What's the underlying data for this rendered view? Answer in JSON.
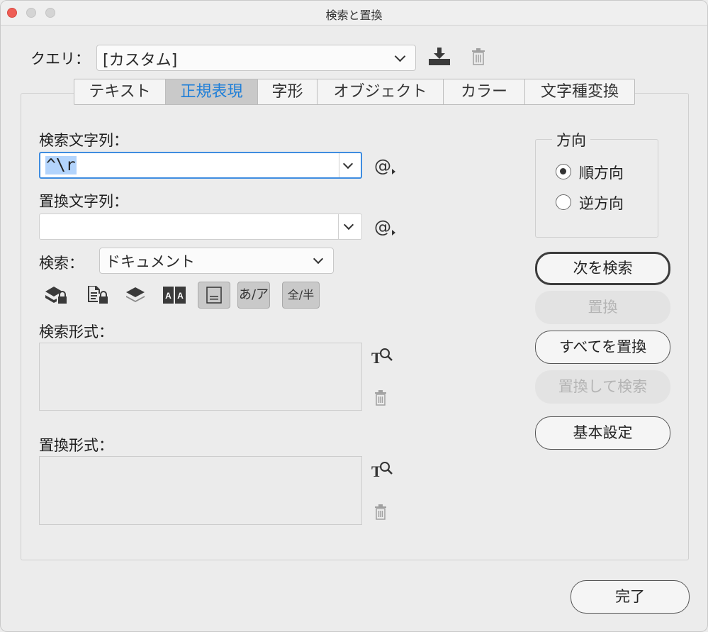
{
  "window": {
    "title": "検索と置換"
  },
  "query": {
    "label": "クエリ：",
    "value": "[カスタム]"
  },
  "tabs": [
    {
      "label": "テキスト"
    },
    {
      "label": "正規表現",
      "active": true
    },
    {
      "label": "字形"
    },
    {
      "label": "オブジェクト"
    },
    {
      "label": "カラー"
    },
    {
      "label": "文字種変換"
    }
  ],
  "find": {
    "label": "検索文字列：",
    "value": "^\\r"
  },
  "change": {
    "label": "置換文字列：",
    "value": ""
  },
  "search": {
    "label": "検索：",
    "value": "ドキュメント"
  },
  "options": {
    "kana_label": "あ/ア",
    "width_label": "全/半"
  },
  "find_format": {
    "label": "検索形式："
  },
  "change_format": {
    "label": "置換形式："
  },
  "direction": {
    "title": "方向",
    "forward": "順方向",
    "backward": "逆方向",
    "selected": "forward"
  },
  "buttons": {
    "find_next": "次を検索",
    "change": "置換",
    "change_all": "すべてを置換",
    "change_find": "置換して検索",
    "more_options": "基本設定",
    "done": "完了"
  },
  "colors": {
    "accent": "#1f7fd8",
    "selection": "#b3d4fc",
    "focus_ring": "#3f8de0"
  }
}
